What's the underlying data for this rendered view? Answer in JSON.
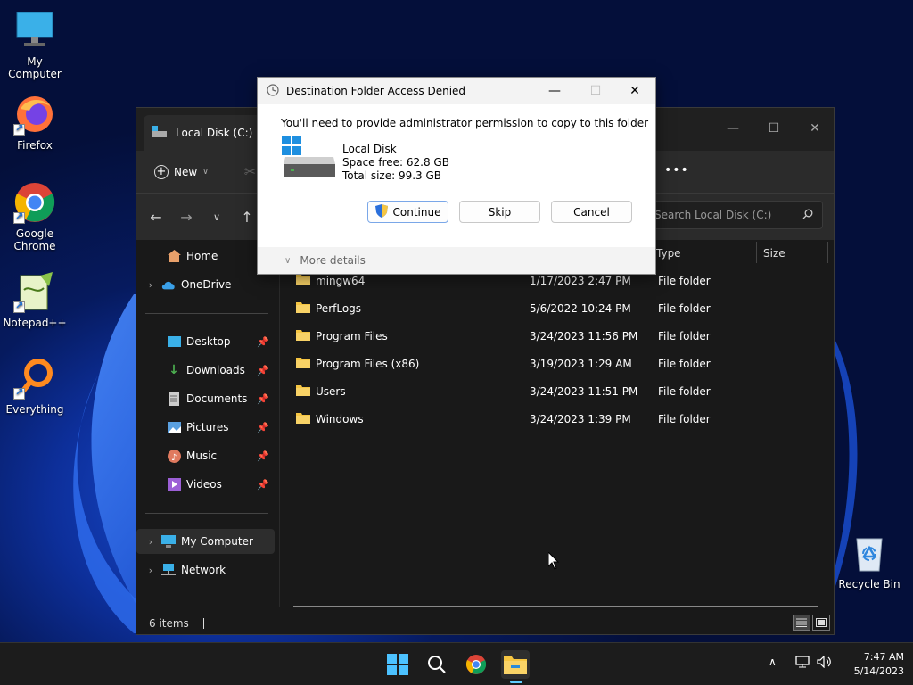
{
  "desktop": {
    "icons": [
      {
        "label": "My Computer"
      },
      {
        "label": "Firefox"
      },
      {
        "label": "Google Chrome"
      },
      {
        "label": "Notepad++"
      },
      {
        "label": "Everything"
      },
      {
        "label": "Recycle Bin"
      }
    ]
  },
  "explorer": {
    "tab_title": "Local Disk (C:)",
    "toolbar": {
      "new_label": "New",
      "more_label": "•••"
    },
    "search_placeholder": "Search Local Disk (C:)",
    "sidebar": {
      "home": "Home",
      "onedrive": "OneDrive",
      "desktop": "Desktop",
      "downloads": "Downloads",
      "documents": "Documents",
      "pictures": "Pictures",
      "music": "Music",
      "videos": "Videos",
      "my_computer": "My Computer",
      "network": "Network"
    },
    "columns": {
      "type": "Type",
      "size": "Size"
    },
    "files": [
      {
        "name": "mingw64",
        "date": "1/17/2023 2:47 PM",
        "type": "File folder"
      },
      {
        "name": "PerfLogs",
        "date": "5/6/2022 10:24 PM",
        "type": "File folder"
      },
      {
        "name": "Program Files",
        "date": "3/24/2023 11:56 PM",
        "type": "File folder"
      },
      {
        "name": "Program Files (x86)",
        "date": "3/19/2023 1:29 AM",
        "type": "File folder"
      },
      {
        "name": "Users",
        "date": "3/24/2023 11:51 PM",
        "type": "File folder"
      },
      {
        "name": "Windows",
        "date": "3/24/2023 1:39 PM",
        "type": "File folder"
      }
    ],
    "status": "6 items"
  },
  "dialog": {
    "title": "Destination Folder Access Denied",
    "message": "You'll need to provide administrator permission to copy to this folder",
    "drive_name": "Local Disk",
    "space_free": "Space free: 62.8 GB",
    "total_size": "Total size: 99.3 GB",
    "continue_label": "Continue",
    "skip_label": "Skip",
    "cancel_label": "Cancel",
    "more_details": "More details"
  },
  "taskbar": {
    "time": "7:47 AM",
    "date": "5/14/2023"
  },
  "colors": {
    "accent": "#60cdff",
    "folder": "#f5c542",
    "dialog_bg": "#ffffff"
  }
}
